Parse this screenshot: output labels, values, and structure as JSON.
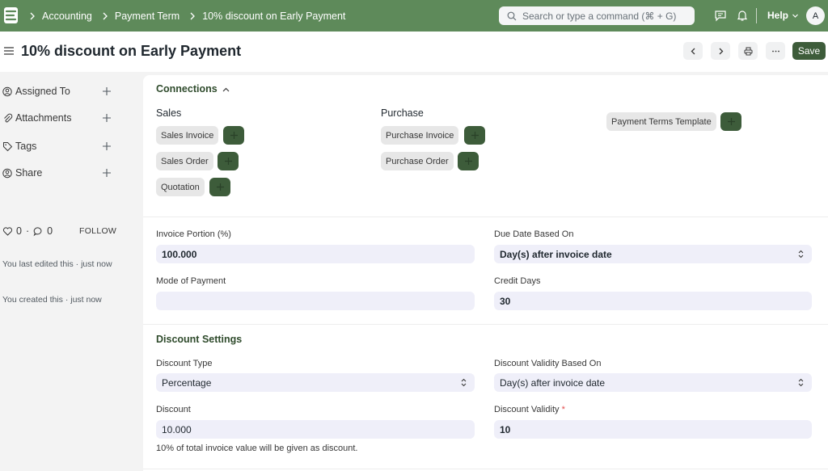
{
  "navbar": {
    "breadcrumbs": [
      "Accounting",
      "Payment Term",
      "10% discount on Early Payment"
    ],
    "search_placeholder": "Search or type a command (⌘ + G)",
    "help_label": "Help",
    "avatar_initial": "A"
  },
  "page": {
    "title": "10% discount on Early Payment",
    "save_label": "Save"
  },
  "sidebar": {
    "assigned_to": "Assigned To",
    "attachments": "Attachments",
    "tags": "Tags",
    "share": "Share",
    "likes_count": "0",
    "comments_count": "0",
    "follow_label": "FOLLOW",
    "last_edited": "You last edited this · just now",
    "created": "You created this · just now"
  },
  "connections": {
    "title": "Connections",
    "sales_label": "Sales",
    "purchase_label": "Purchase",
    "sales_items": [
      "Sales Invoice",
      "Sales Order",
      "Quotation"
    ],
    "purchase_items": [
      "Purchase Invoice",
      "Purchase Order"
    ],
    "other_items": [
      "Payment Terms Template"
    ]
  },
  "form": {
    "invoice_portion_label": "Invoice Portion (%)",
    "invoice_portion_value": "100.000",
    "due_date_label": "Due Date Based On",
    "due_date_value": "Day(s) after invoice date",
    "mode_of_payment_label": "Mode of Payment",
    "mode_of_payment_value": "",
    "credit_days_label": "Credit Days",
    "credit_days_value": "30"
  },
  "discount": {
    "title": "Discount Settings",
    "type_label": "Discount Type",
    "type_value": "Percentage",
    "validity_based_label": "Discount Validity Based On",
    "validity_based_value": "Day(s) after invoice date",
    "discount_label": "Discount",
    "discount_value": "10.000",
    "discount_help": "10% of total invoice value will be given as discount.",
    "validity_label": "Discount Validity",
    "validity_required": "*",
    "validity_value": "10"
  },
  "colors": {
    "navbar": "#5e8a5a",
    "primary": "#3d5c3a",
    "section_title": "#2f4b2c"
  }
}
